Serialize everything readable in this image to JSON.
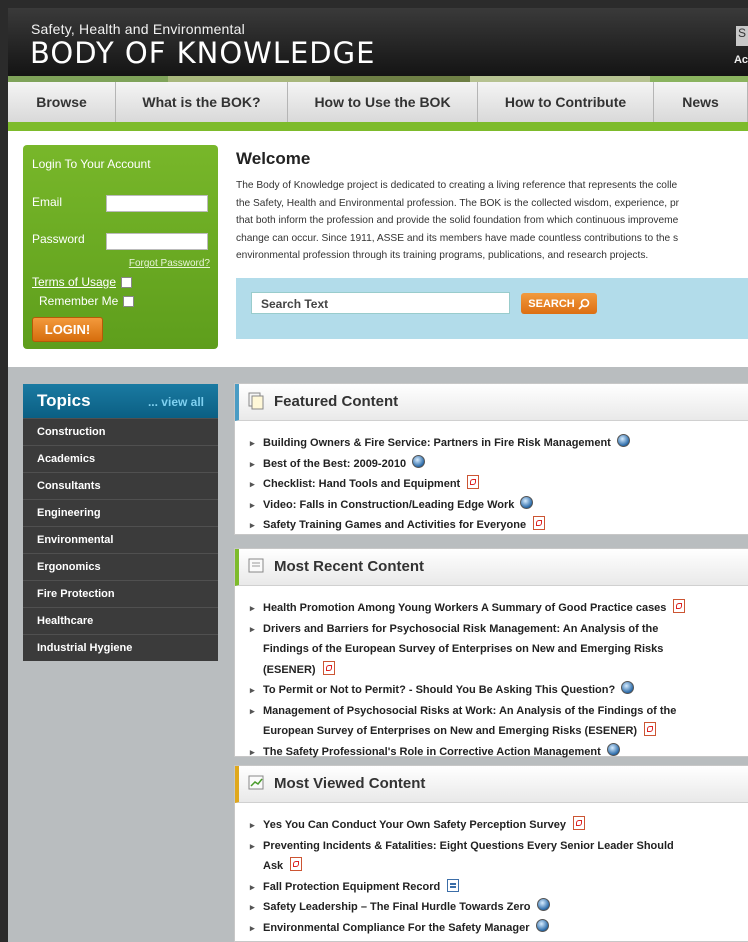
{
  "header": {
    "tagline": "Safety, Health and Environmental",
    "title": "BODY OF KNOWLEDGE",
    "right_top": "S",
    "right_bottom": "Ac"
  },
  "nav": [
    "Browse",
    "What is the BOK?",
    "How to Use the BOK",
    "How to Contribute",
    "News"
  ],
  "login": {
    "title": "Login To Your Account",
    "email_label": "Email",
    "password_label": "Password",
    "forgot": "Forgot Password?",
    "terms": "Terms of Usage",
    "remember": "Remember Me",
    "button": "LOGIN!"
  },
  "welcome": {
    "title": "Welcome",
    "lines": [
      "The Body of Knowledge project is dedicated to creating a living reference that represents the colle",
      "the Safety, Health and Environmental profession. The BOK is the collected wisdom, experience, pr",
      "that both inform the profession and provide the solid foundation from which continuous improveme",
      "change can occur. Since 1911, ASSE and its members have made countless contributions to the s",
      "environmental profession through its training programs, publications, and research projects."
    ]
  },
  "search": {
    "placeholder": "Search Text",
    "button": "SEARCH"
  },
  "topics": {
    "title": "Topics",
    "view_all": "... view all",
    "items": [
      "Construction",
      "Academics",
      "Consultants",
      "Engineering",
      "Environmental",
      "Ergonomics",
      "Fire Protection",
      "Healthcare",
      "Industrial Hygiene"
    ]
  },
  "featured": {
    "title": "Featured Content",
    "items": [
      {
        "lines": [
          "Building Owners & Fire Service: Partners in Fire Risk Management"
        ],
        "icon": "globe-icon"
      },
      {
        "lines": [
          "Best of the Best: 2009-2010"
        ],
        "icon": "globe-icon"
      },
      {
        "lines": [
          "Checklist: Hand Tools and Equipment"
        ],
        "icon": "pdf-icon"
      },
      {
        "lines": [
          "Video: Falls in Construction/Leading Edge Work"
        ],
        "icon": "globe-icon"
      },
      {
        "lines": [
          "Safety Training Games and Activities for Everyone"
        ],
        "icon": "pdf-icon"
      }
    ]
  },
  "recent": {
    "title": "Most Recent Content",
    "items": [
      {
        "lines": [
          "Health Promotion Among Young Workers A Summary of Good Practice cases"
        ],
        "icon": "pdf-icon"
      },
      {
        "lines": [
          "Drivers and Barriers for Psychosocial Risk Management: An Analysis of the",
          "Findings of the European Survey of Enterprises on New and Emerging Risks",
          "(ESENER)"
        ],
        "icon": "pdf-icon"
      },
      {
        "lines": [
          "To Permit or Not to Permit? - Should You Be Asking This Question?"
        ],
        "icon": "globe-icon"
      },
      {
        "lines": [
          "Management of Psychosocial Risks at Work: An Analysis of the Findings of the",
          "European Survey of Enterprises on New and Emerging Risks (ESENER)"
        ],
        "icon": "pdf-icon"
      },
      {
        "lines": [
          "The Safety Professional's Role in Corrective Action Management"
        ],
        "icon": "globe-icon"
      }
    ]
  },
  "viewed": {
    "title": "Most Viewed Content",
    "items": [
      {
        "lines": [
          "Yes You Can Conduct Your Own Safety Perception Survey"
        ],
        "icon": "pdf-icon"
      },
      {
        "lines": [
          "Preventing Incidents & Fatalities: Eight Questions Every Senior Leader Should",
          "Ask"
        ],
        "icon": "pdf-icon"
      },
      {
        "lines": [
          "Fall Protection Equipment Record"
        ],
        "icon": "doc-icon"
      },
      {
        "lines": [
          "Safety Leadership – The Final Hurdle Towards Zero"
        ],
        "icon": "globe-icon"
      },
      {
        "lines": [
          "Environmental Compliance For the Safety Manager"
        ],
        "icon": "globe-icon"
      }
    ]
  },
  "colors": {
    "green": "#7dbb2b",
    "blue": "#0b5f83",
    "orange": "#dc6f12"
  }
}
